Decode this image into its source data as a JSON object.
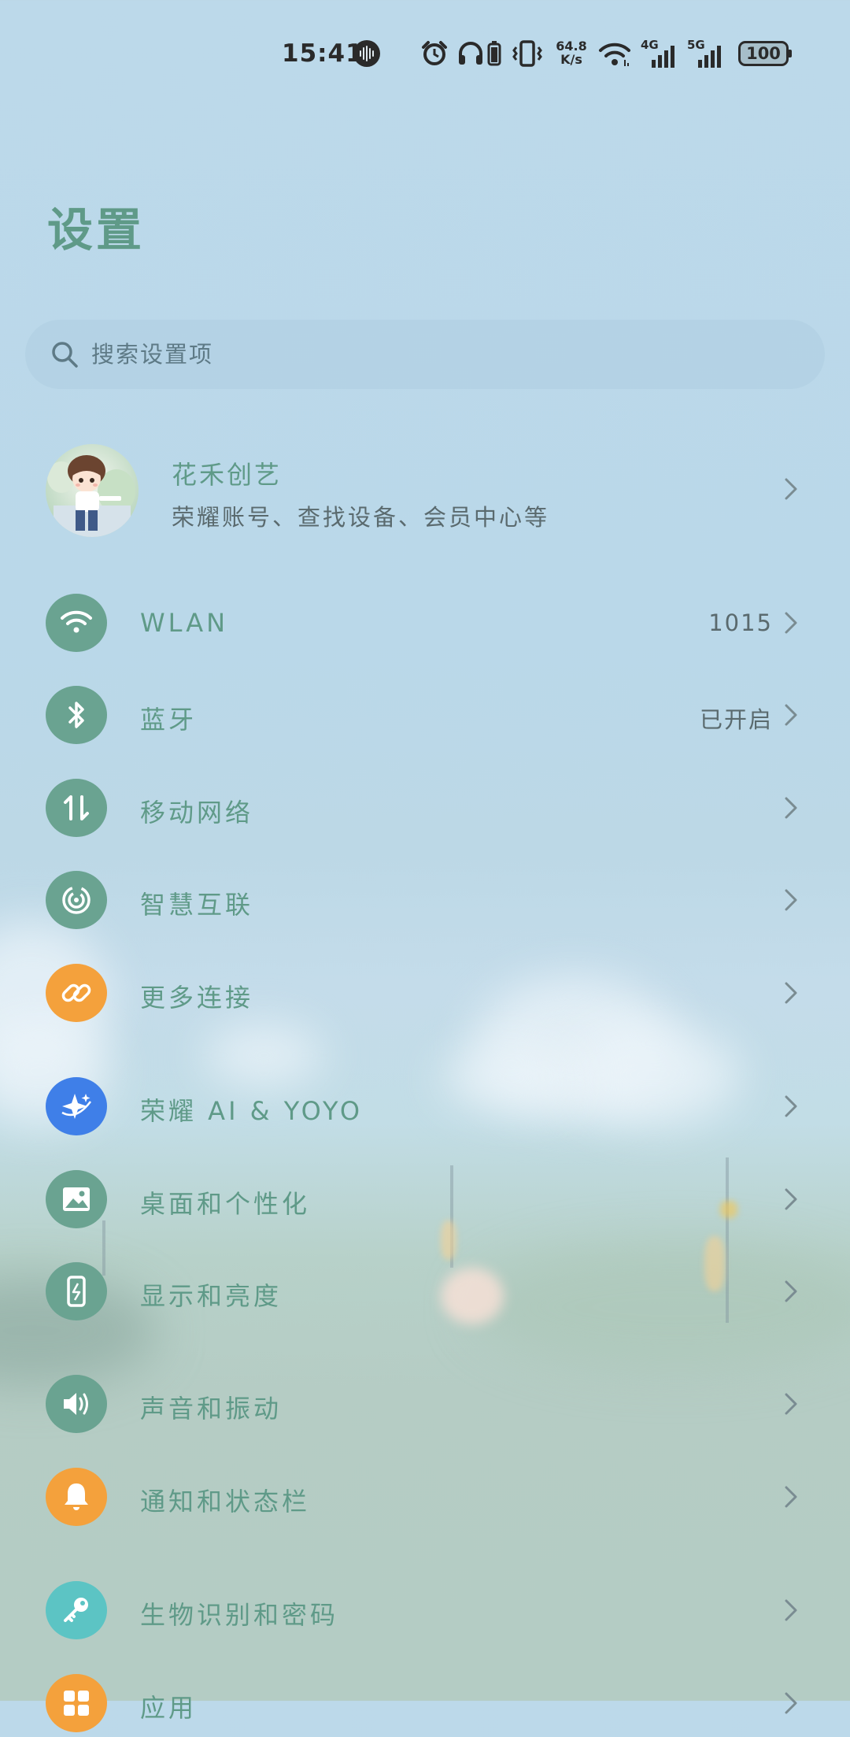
{
  "status_bar": {
    "time": "15:41",
    "net_speed_value": "64.8",
    "net_speed_unit": "K/s",
    "network_4g": "4G",
    "network_5g": "5G",
    "battery": "100"
  },
  "page": {
    "title": "设置"
  },
  "search": {
    "placeholder": "搜索设置项"
  },
  "account": {
    "name": "花禾创艺",
    "subtitle": "荣耀账号、查找设备、会员中心等"
  },
  "settings": [
    {
      "label": "WLAN",
      "value": "1015",
      "icon": "wifi-icon",
      "color": "#6aa391"
    },
    {
      "label": "蓝牙",
      "value": "已开启",
      "icon": "bluetooth-icon",
      "color": "#6aa391"
    },
    {
      "label": "移动网络",
      "value": "",
      "icon": "mobile-data-icon",
      "color": "#6aa391"
    },
    {
      "label": "智慧互联",
      "value": "",
      "icon": "smart-connect-icon",
      "color": "#6aa391"
    },
    {
      "label": "更多连接",
      "value": "",
      "icon": "link-icon",
      "color": "#f4a13c"
    },
    {
      "label": "荣耀 AI & YOYO",
      "value": "",
      "icon": "sparkle-icon",
      "color": "#3f7fe8"
    },
    {
      "label": "桌面和个性化",
      "value": "",
      "icon": "image-icon",
      "color": "#6aa391"
    },
    {
      "label": "显示和亮度",
      "value": "",
      "icon": "display-icon",
      "color": "#6aa391"
    },
    {
      "label": "声音和振动",
      "value": "",
      "icon": "speaker-icon",
      "color": "#6aa391"
    },
    {
      "label": "通知和状态栏",
      "value": "",
      "icon": "bell-icon",
      "color": "#f4a13c"
    },
    {
      "label": "生物识别和密码",
      "value": "",
      "icon": "key-icon",
      "color": "#5cc4c4"
    },
    {
      "label": "应用",
      "value": "",
      "icon": "apps-icon",
      "color": "#f4a13c"
    }
  ]
}
